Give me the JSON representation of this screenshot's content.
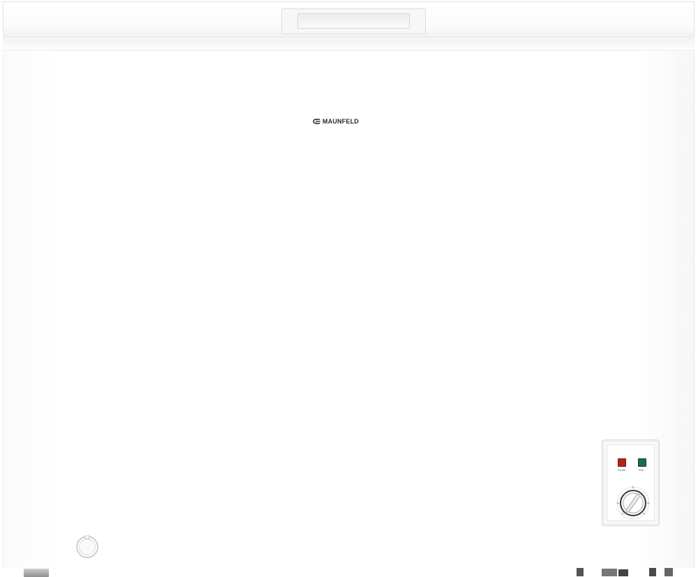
{
  "product": {
    "brand": "MAUNFELD",
    "type": "chest-freezer"
  },
  "control_panel": {
    "indicators": [
      {
        "name": "power-indicator",
        "label": "Power",
        "color": "#b32222"
      },
      {
        "name": "run-indicator",
        "label": "Run",
        "color": "#1d6b4d"
      }
    ],
    "knob_marks": [
      "7",
      "1",
      "Max",
      "0"
    ]
  },
  "colors": {
    "body": "#ffffff",
    "outline": "#e2e2e2",
    "brand_text": "#2a2a2a"
  }
}
